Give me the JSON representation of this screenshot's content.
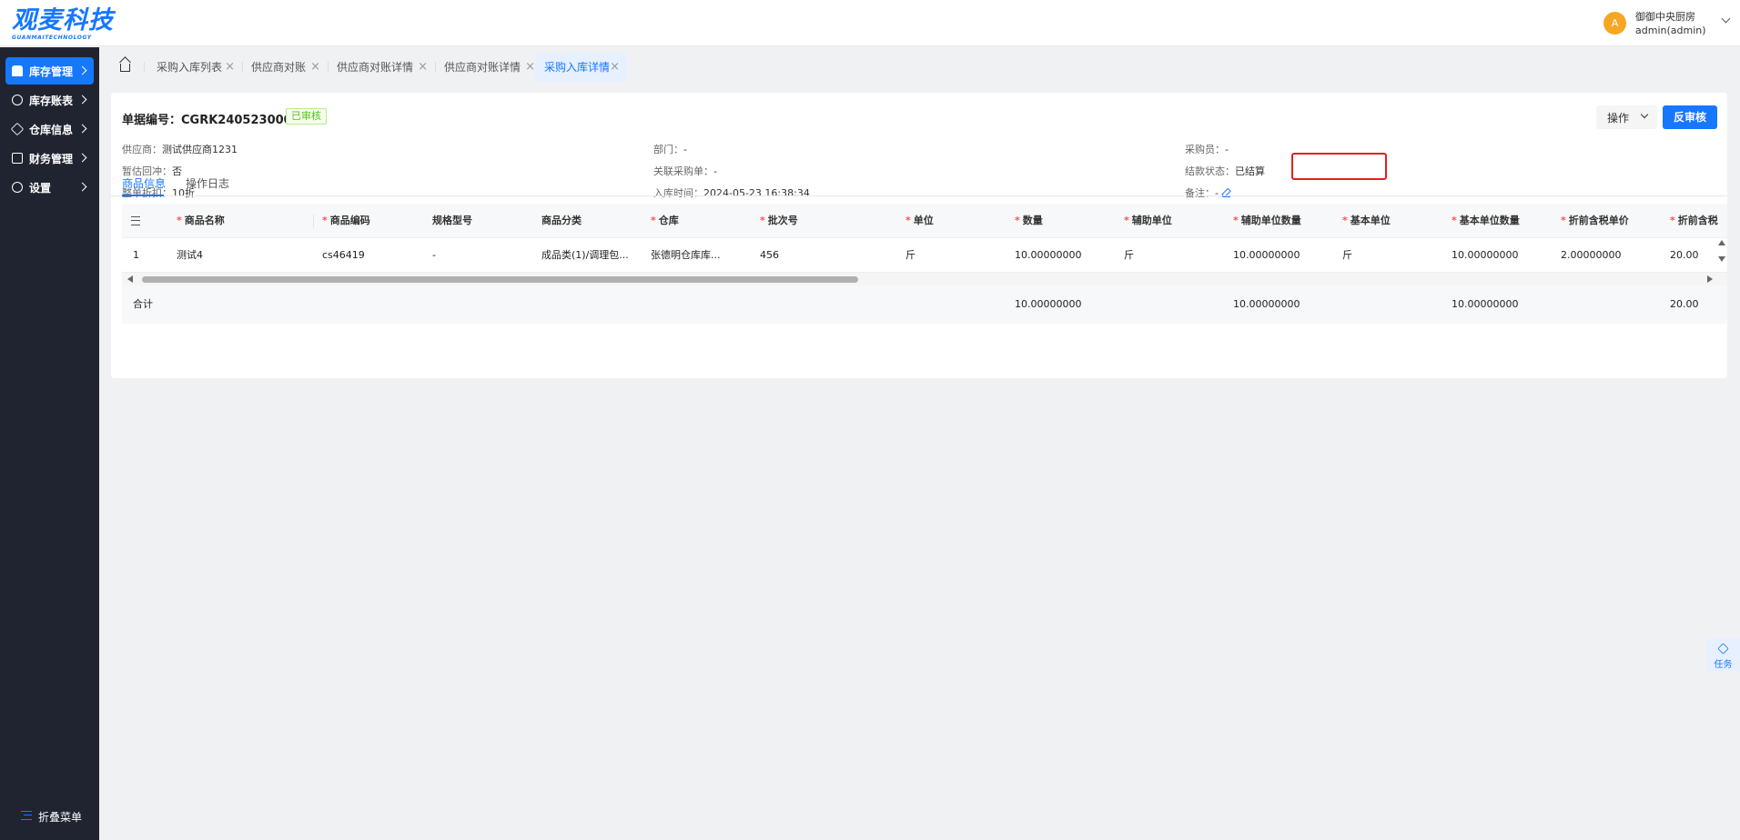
{
  "header": {
    "logo_cn": "观麦科技",
    "logo_en": "GUANMAITECHNOLOGY",
    "user_initial": "A",
    "user_name": "御御中央厨房",
    "user_account": "admin(admin)"
  },
  "sidebar": {
    "items": [
      {
        "label": "库存管理",
        "icon": "warehouse-icon",
        "active": true
      },
      {
        "label": "库存账表",
        "icon": "chart-icon",
        "active": false
      },
      {
        "label": "仓库信息",
        "icon": "box-icon",
        "active": false
      },
      {
        "label": "财务管理",
        "icon": "finance-icon",
        "active": false
      },
      {
        "label": "设置",
        "icon": "gear-icon",
        "active": false
      }
    ],
    "collapse_label": "折叠菜单"
  },
  "tabs": [
    {
      "label": "采购入库列表",
      "active": false
    },
    {
      "label": "供应商对账",
      "active": false
    },
    {
      "label": "供应商对账详情",
      "active": false
    },
    {
      "label": "供应商对账详情",
      "active": false
    },
    {
      "label": "采购入库详情",
      "active": true
    }
  ],
  "doc": {
    "title": "单据编号：CGRK24052300002",
    "status": "已审核",
    "op_button": "操作",
    "reverse_button": "反审核",
    "fields": {
      "supplier_k": "供应商：",
      "supplier_v": "测试供应商1231",
      "dept_k": "部门：",
      "dept_v": "-",
      "buyer_k": "采购员：",
      "buyer_v": "-",
      "offset_k": "暂估回冲：",
      "offset_v": "否",
      "po_k": "关联采购单：",
      "po_v": "-",
      "settle_k": "结款状态：",
      "settle_v": "已结算",
      "discount_k": "整单折扣：",
      "discount_v": "10折",
      "time_k": "入库时间：",
      "time_v": "2024-05-23 16:38:34",
      "remark_k": "备注：",
      "remark_v": "-"
    }
  },
  "subtabs": {
    "goods": "商品信息",
    "log": "操作日志"
  },
  "table": {
    "headers": {
      "name": "商品名称",
      "code": "商品编码",
      "spec": "规格型号",
      "category": "商品分类",
      "warehouse": "仓库",
      "batch": "批次号",
      "unit": "单位",
      "qty": "数量",
      "aux_unit": "辅助单位",
      "aux_qty": "辅助单位数量",
      "base_unit": "基本单位",
      "base_qty": "基本单位数量",
      "price_pre": "折前含税单价",
      "amount_pre": "折前含税"
    },
    "row": {
      "idx": "1",
      "name": "测试4",
      "code": "cs46419",
      "spec": "-",
      "category": "成品类(1)/调理包...",
      "warehouse": "张德明仓库库...",
      "batch": "456",
      "unit": "斤",
      "qty": "10.00000000",
      "aux_unit": "斤",
      "aux_qty": "10.00000000",
      "base_unit": "斤",
      "base_qty": "10.00000000",
      "price_pre": "2.00000000",
      "amount_pre": "20.00"
    },
    "footer": {
      "label": "合计",
      "qty": "10.00000000",
      "aux_qty": "10.00000000",
      "base_qty": "10.00000000",
      "amount_pre": "20.00"
    },
    "required_mark": "*"
  },
  "task": {
    "label": "任务"
  },
  "colors": {
    "accent": "#1677ff",
    "sidebar": "#1f2430",
    "highlight": "#e02020"
  }
}
